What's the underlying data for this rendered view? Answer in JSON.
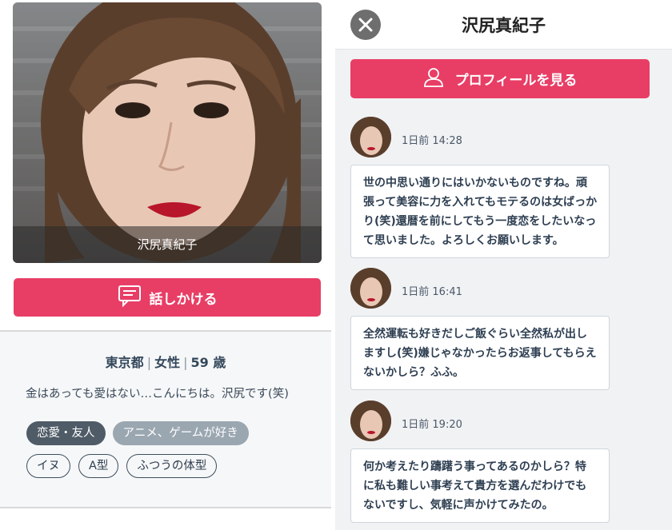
{
  "profile": {
    "name": "沢尻真紀子",
    "talk_button": "話しかける",
    "location": "東京都",
    "gender": "女性",
    "age": "59 歳",
    "bio": "金はあっても愛はない…こんにちは。沢尻です(笑)",
    "tags_primary": [
      {
        "label": "恋愛・友人",
        "color": "#4f5b66"
      },
      {
        "label": "アニメ、ゲームが好き",
        "color": "#9aa6b0"
      }
    ],
    "tags_secondary": [
      "イヌ",
      "A型",
      "ふつうの体型"
    ]
  },
  "chat": {
    "title": "沢尻真紀子",
    "profile_button": "プロフィールを見る",
    "messages": [
      {
        "time": "1日前 14:28",
        "lines": [
          "世の中思い通りにはいかないものですね。頑",
          "張って美容に力を入れてもモテるのは女ばっか",
          "り(笑)還暦を前にしてもう一度恋をしたいなっ",
          "て思いました。よろしくお願いします。"
        ]
      },
      {
        "time": "1日前 16:41",
        "lines": [
          "全然運転も好きだしご飯ぐらい全然私が出し",
          "ますし(笑)嫌じゃなかったらお返事してもらえ",
          "ないかしら？ふふ。"
        ]
      },
      {
        "time": "1日前 19:20",
        "lines": [
          "何か考えたり躊躇う事ってあるのかしら？特",
          "に私も難しい事考えて貴方を選んだわけでも",
          "ないですし、気軽に声かけてみたの。"
        ]
      }
    ]
  },
  "colors": {
    "accent": "#e83e66",
    "tag_dark": "#4f5b66",
    "tag_light": "#9aa6b0"
  },
  "icons": {
    "talk_button": "speech-bubble-icon",
    "profile_button": "person-icon",
    "close": "close-icon"
  }
}
